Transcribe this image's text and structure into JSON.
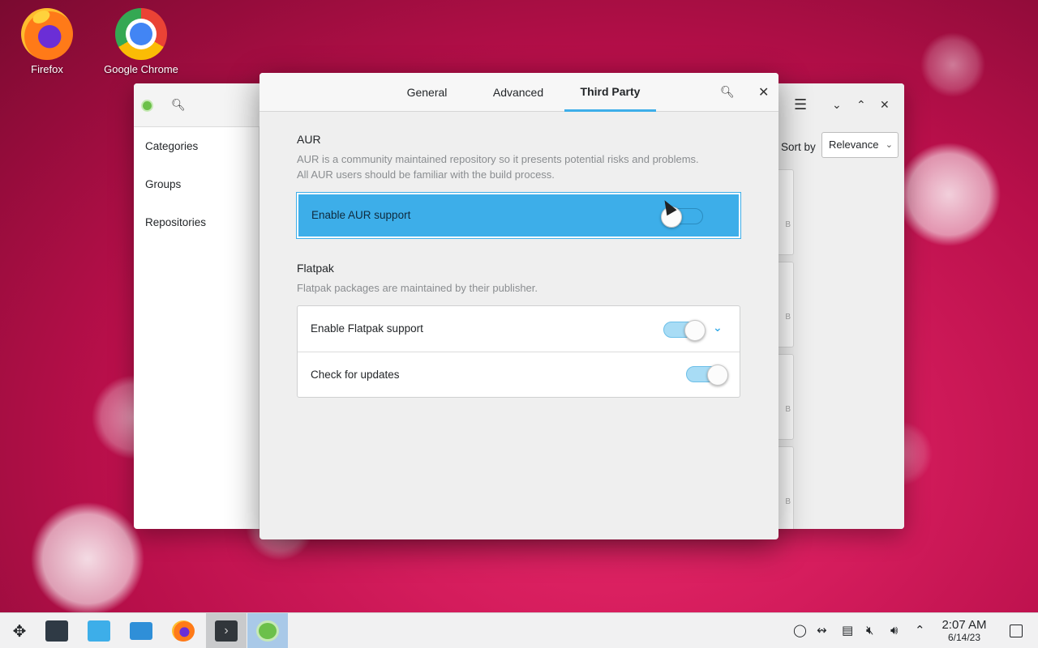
{
  "desktop": {
    "icons": [
      {
        "label": "Firefox",
        "icon": "firefox-icon"
      },
      {
        "label": "Google Chrome",
        "icon": "chrome-icon"
      }
    ]
  },
  "background_window": {
    "sidebar": [
      "Categories",
      "Groups",
      "Repositories"
    ],
    "sort_label": "Sort by",
    "sort_value": "Relevance",
    "card_suffix": "B"
  },
  "dialog": {
    "tabs": [
      "General",
      "Advanced",
      "Third Party"
    ],
    "active_tab": "Third Party",
    "aur": {
      "title": "AUR",
      "description_line1": "AUR is a community maintained repository so it presents potential risks and problems.",
      "description_line2": "All AUR users should be familiar with the build process.",
      "enable_label": "Enable AUR support",
      "enabled": false
    },
    "flatpak": {
      "title": "Flatpak",
      "description": "Flatpak packages are maintained by their publisher.",
      "enable_label": "Enable Flatpak support",
      "enabled": true,
      "updates_label": "Check for updates",
      "updates_enabled": true
    }
  },
  "taskbar": {
    "time": "2:07 AM",
    "date": "6/14/23",
    "accent": "#3daee9"
  }
}
